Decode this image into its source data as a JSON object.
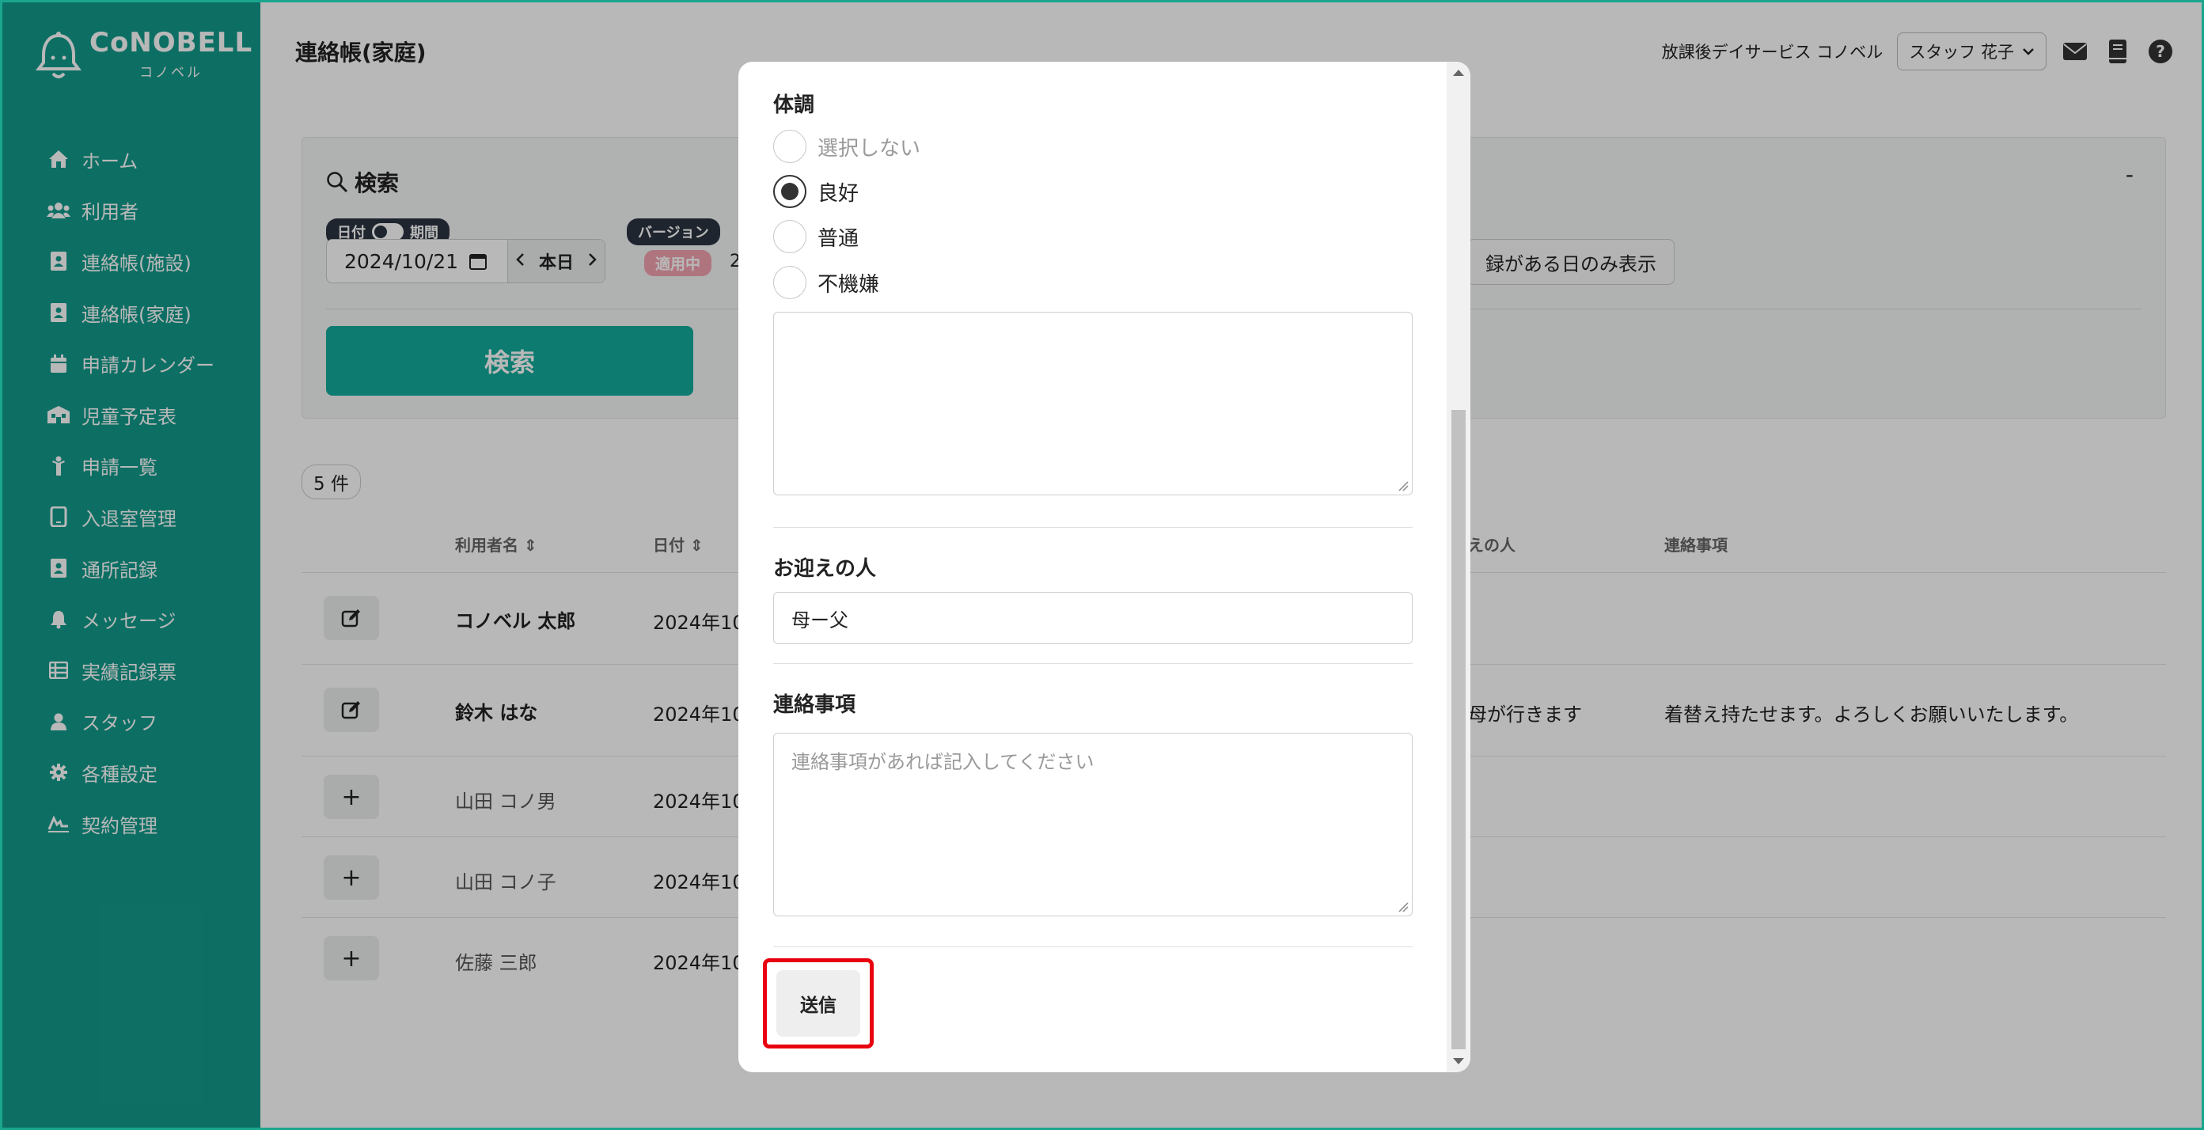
{
  "brand": {
    "name": "CoNOBELL",
    "sub": "コノベル"
  },
  "sidebar": {
    "items": [
      {
        "label": "ホーム",
        "icon": "home-icon"
      },
      {
        "label": "利用者",
        "icon": "users-icon"
      },
      {
        "label": "連絡帳(施設)",
        "icon": "contact-book-icon"
      },
      {
        "label": "連絡帳(家庭)",
        "icon": "contact-book-icon"
      },
      {
        "label": "申請カレンダー",
        "icon": "calendar-icon"
      },
      {
        "label": "児童予定表",
        "icon": "schedule-icon"
      },
      {
        "label": "申請一覧",
        "icon": "person-icon"
      },
      {
        "label": "入退室管理",
        "icon": "tablet-icon"
      },
      {
        "label": "通所記録",
        "icon": "record-icon"
      },
      {
        "label": "メッセージ",
        "icon": "bell-icon"
      },
      {
        "label": "実績記録票",
        "icon": "table-icon"
      },
      {
        "label": "スタッフ",
        "icon": "staff-icon"
      },
      {
        "label": "各種設定",
        "icon": "gear-icon"
      },
      {
        "label": "契約管理",
        "icon": "contract-icon"
      }
    ]
  },
  "header": {
    "title": "連絡帳(家庭)",
    "facility": "放課後デイサービス コノベル",
    "staff": "スタッフ 花子"
  },
  "search": {
    "title": "検索",
    "collapse": "-",
    "date_pill_left": "日付",
    "date_pill_right": "期間",
    "date_value": "2024/10/21",
    "today": "本日",
    "version_pill": "バージョン",
    "version_badge": "適用中",
    "version_digit": "2",
    "record_only": "録がある日のみ表示",
    "button": "検索"
  },
  "results": {
    "count": "5 件",
    "headers": {
      "name": "利用者名",
      "date": "日付",
      "pickup": "えの人",
      "notes": "連絡事項"
    },
    "rows": [
      {
        "action": "edit",
        "name": "コノベル 太郎",
        "date": "2024年10",
        "pickup": "",
        "notes": "",
        "bold": true
      },
      {
        "action": "edit",
        "name": "鈴木 はな",
        "date": "2024年10",
        "pickup": "母が行きます",
        "notes": "着替え持たせます。よろしくお願いいたします。",
        "bold": true
      },
      {
        "action": "add",
        "name": "山田 コノ男",
        "date": "2024年10",
        "pickup": "",
        "notes": "",
        "bold": false
      },
      {
        "action": "add",
        "name": "山田 コノ子",
        "date": "2024年10",
        "pickup": "",
        "notes": "",
        "bold": false
      },
      {
        "action": "add",
        "name": "佐藤 三郎",
        "date": "2024年10",
        "pickup": "",
        "notes": "",
        "bold": false
      }
    ]
  },
  "modal": {
    "condition_label": "体調",
    "condition_options": [
      {
        "label": "選択しない",
        "checked": false,
        "muted": true
      },
      {
        "label": "良好",
        "checked": true,
        "muted": false
      },
      {
        "label": "普通",
        "checked": false,
        "muted": false
      },
      {
        "label": "不機嫌",
        "checked": false,
        "muted": false
      }
    ],
    "pickup_label": "お迎えの人",
    "pickup_value": "母ー父",
    "notes_label": "連絡事項",
    "notes_placeholder": "連絡事項があれば記入してください",
    "submit": "送信"
  },
  "colors": {
    "brand": "#139a8b",
    "button": "#13ab9a",
    "highlight": "#e8000f"
  }
}
